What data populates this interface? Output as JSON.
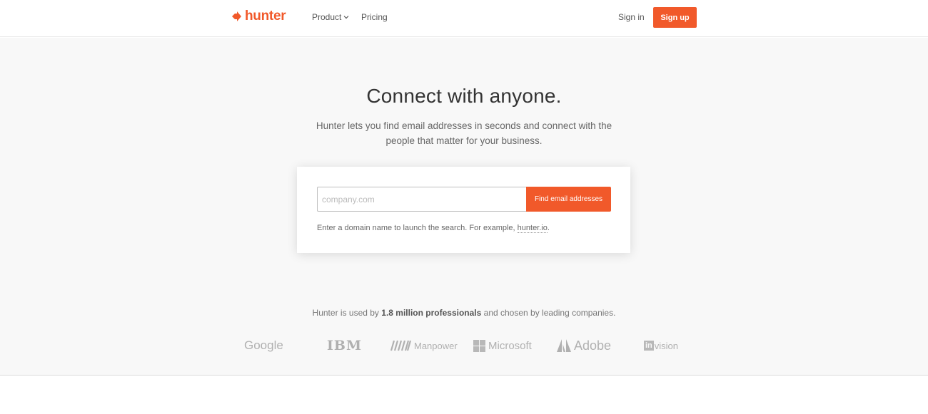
{
  "header": {
    "brand": "hunter",
    "nav": {
      "product": "Product",
      "pricing": "Pricing"
    },
    "sign_in": "Sign in",
    "sign_up": "Sign up",
    "brand_color": "#f1592a"
  },
  "hero": {
    "title": "Connect with anyone.",
    "subtitle": "Hunter lets you find email addresses in seconds and connect with the people that matter for your business."
  },
  "search": {
    "placeholder": "company.com",
    "value": "",
    "button": "Find email addresses",
    "hint_prefix": "Enter a domain name to launch the search. For example, ",
    "hint_link": "hunter.io",
    "hint_suffix": "."
  },
  "social_proof": {
    "prefix": "Hunter is used by ",
    "highlight": "1.8 million professionals",
    "suffix": " and chosen by leading companies."
  },
  "companies": {
    "google": "Google",
    "ibm": "IBM",
    "manpower": "Manpower",
    "microsoft": "Microsoft",
    "adobe": "Adobe",
    "invision_box": "in",
    "invision_rest": "vision"
  }
}
